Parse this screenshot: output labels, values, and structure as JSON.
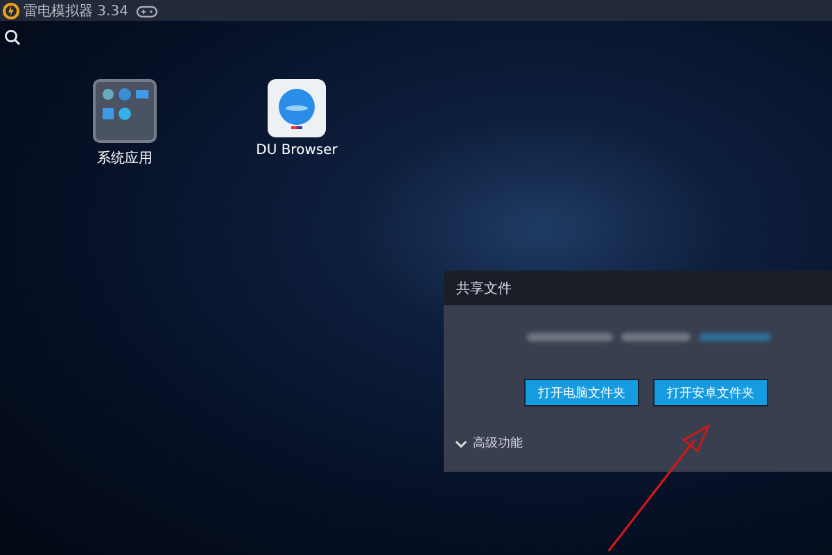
{
  "window": {
    "title": "雷电模拟器 3.34"
  },
  "desktop": {
    "apps": [
      {
        "label": "系统应用",
        "kind": "folder"
      },
      {
        "label": "DU Browser",
        "kind": "app"
      }
    ]
  },
  "dialog": {
    "title": "共享文件",
    "buttons": [
      "打开电脑文件夹",
      "打开安卓文件夹"
    ],
    "advanced": {
      "label": "高级功能",
      "expanded": false
    }
  }
}
